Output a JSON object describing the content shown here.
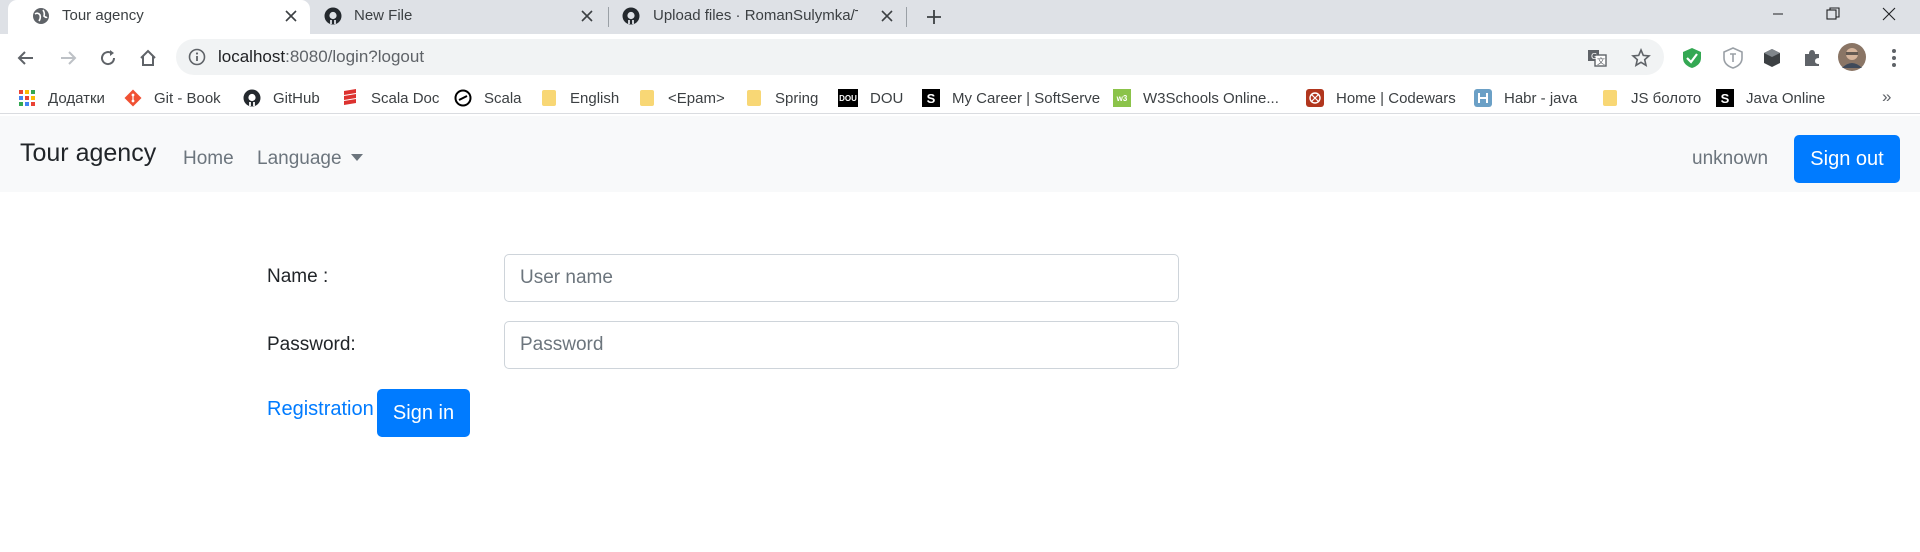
{
  "browser": {
    "tabs": [
      {
        "title": "Tour agency",
        "active": true,
        "icon": "globe-icon"
      },
      {
        "title": "New File",
        "active": false,
        "icon": "github-icon"
      },
      {
        "title": "Upload files · RomanSulymka/Tra",
        "active": false,
        "icon": "github-icon"
      }
    ],
    "url_host": "localhost",
    "url_rest": ":8080/login?logout",
    "bookmarks": [
      {
        "label": "Додатки",
        "icon": "apps-grid-icon",
        "color": "#ea4335"
      },
      {
        "label": "Git - Book",
        "icon": "git-icon",
        "color": "#f05133"
      },
      {
        "label": "GitHub",
        "icon": "github-icon",
        "color": "#24292e"
      },
      {
        "label": "Scala Doc",
        "icon": "scala-icon",
        "color": "#dc322f"
      },
      {
        "label": "Scala",
        "icon": "scala-ring-icon",
        "color": "#000000"
      },
      {
        "label": "English",
        "icon": "folder-icon",
        "color": "#f8d775"
      },
      {
        "label": "<Epam>",
        "icon": "folder-icon",
        "color": "#f8d775"
      },
      {
        "label": "Spring",
        "icon": "folder-icon",
        "color": "#f8d775"
      },
      {
        "label": "DOU",
        "icon": "dou-icon",
        "color": "#000000"
      },
      {
        "label": "My Career | SoftServe",
        "icon": "softserve-icon",
        "color": "#000000"
      },
      {
        "label": "W3Schools Online...",
        "icon": "w3schools-icon",
        "color": "#8bc34a"
      },
      {
        "label": "Home | Codewars",
        "icon": "codewars-icon",
        "color": "#b1361e"
      },
      {
        "label": "Habr - java",
        "icon": "habr-icon",
        "color": "#6ba0c6"
      },
      {
        "label": "JS болото",
        "icon": "folder-icon",
        "color": "#f8d775"
      },
      {
        "label": "Java Online",
        "icon": "softserve-icon",
        "color": "#000000"
      }
    ],
    "bookmarks_more": "»"
  },
  "app": {
    "brand": "Tour agency",
    "nav_home": "Home",
    "nav_language": "Language",
    "user": "unknown",
    "sign_out": "Sign out"
  },
  "form": {
    "name_label": "Name :",
    "name_placeholder": "User name",
    "password_label": "Password:",
    "password_placeholder": "Password",
    "registration_link": "Registration",
    "sign_in": "Sign in"
  },
  "colors": {
    "primary": "#007bff",
    "navbar_bg": "#f8f9fa",
    "tabstrip_bg": "#dee1e6"
  }
}
